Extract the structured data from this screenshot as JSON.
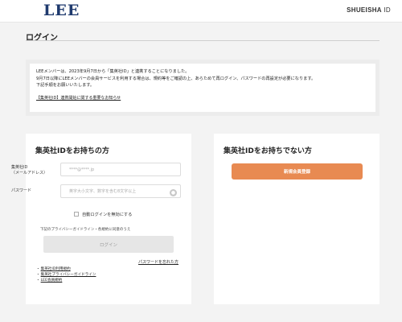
{
  "header": {
    "logo": "LEE",
    "brand_main": "SHUEISHA",
    "brand_suffix": " ID"
  },
  "page_title": "ログイン",
  "notice": {
    "lines": [
      "LEEメンバーは、2023年9月7日から「集英社ID」と連携することになりました。",
      "9月7日以降にLEEメンバーの会員サービスを利用する場合は、規約等をご確認の上、あらためて再ログイン、パスワードの再設定が必要になります。",
      "下記手順をお願いいたします。"
    ],
    "link": "【集英社ID】連携開始に関する重要なお知らせ"
  },
  "left_panel": {
    "title": "集英社IDをお持ちの方",
    "id_label_1": "集英社ID",
    "id_label_2": "（メールアドレス）",
    "id_placeholder": "****@****.jp",
    "password_label": "パスワード",
    "password_placeholder": "英字大小文字、数字を含む8文字以上",
    "auto_login_label": "自動ログインを無効にする",
    "agree_text": "下記のプライバシーガイドライン・各規約に同意のうえ",
    "login_button": "ログイン",
    "forgot_password": "パスワードを忘れた方",
    "policy_links": [
      "集英社ID利用規約",
      "集英社プライバシーガイドライン",
      "LEE会員規約"
    ]
  },
  "right_panel": {
    "title": "集英社IDをお持ちでない方",
    "register_button": "新規会員登録"
  },
  "colors": {
    "logo": "#1f3a6e",
    "register_button": "#e88a52",
    "background": "#f3f3f3"
  }
}
